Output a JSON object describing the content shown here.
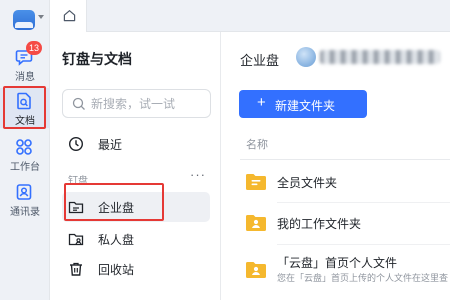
{
  "rail": {
    "items": [
      {
        "label": "消息",
        "icon": "chat-bubble-icon",
        "badge": "13"
      },
      {
        "label": "文档",
        "icon": "document-icon",
        "active": true
      },
      {
        "label": "工作台",
        "icon": "apps-grid-icon"
      },
      {
        "label": "通讯录",
        "icon": "contacts-icon"
      }
    ]
  },
  "tabs": {
    "home_icon": "home-icon"
  },
  "sidebar": {
    "title": "钉盘与文档",
    "search_placeholder": "新搜索，试一试",
    "recent_label": "最近",
    "section_label": "钉盘",
    "more_label": "···",
    "items": [
      {
        "label": "企业盘",
        "icon": "enterprise-drive-icon",
        "active": true
      },
      {
        "label": "私人盘",
        "icon": "private-drive-icon"
      },
      {
        "label": "回收站",
        "icon": "trash-icon"
      }
    ]
  },
  "main": {
    "title": "企业盘",
    "new_folder_label": "新建文件夹",
    "new_folder_plus": "+",
    "column_name": "名称",
    "files": [
      {
        "name": "全员文件夹",
        "icon": "shared-folder-icon"
      },
      {
        "name": "我的工作文件夹",
        "icon": "user-folder-icon"
      },
      {
        "name": "「云盘」首页个人文件",
        "desc": "您在「云盘」首页上传的个人文件在这里查",
        "icon": "user-folder-icon"
      }
    ]
  },
  "colors": {
    "accent": "#3370ff",
    "folder": "#f5b82e",
    "highlight": "#e53935"
  }
}
